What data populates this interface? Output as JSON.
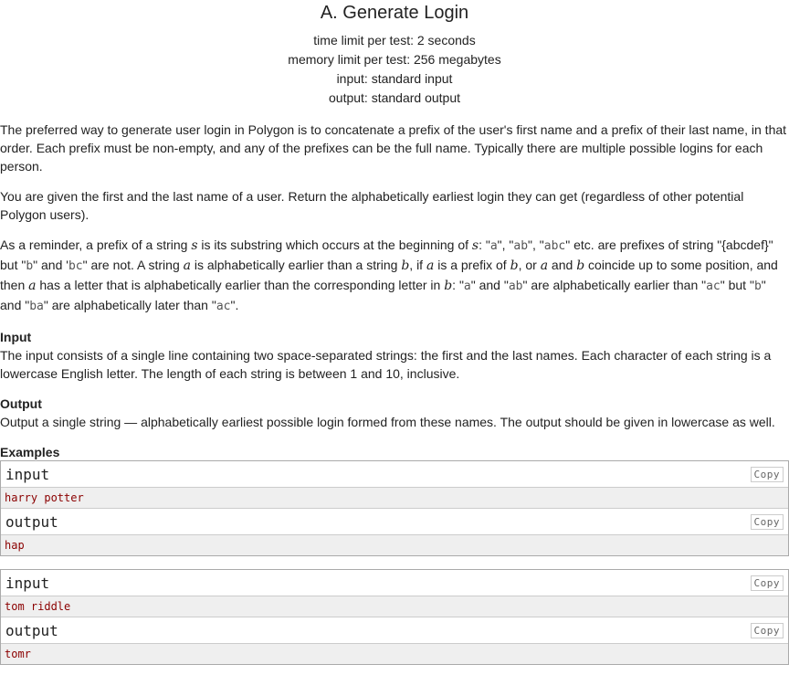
{
  "problem": {
    "title": "A. Generate Login",
    "time_limit": "time limit per test: 2 seconds",
    "memory_limit": "memory limit per test: 256 megabytes",
    "input": "input: standard input",
    "output": "output: standard output"
  },
  "statement": {
    "p1": "The preferred way to generate user login in Polygon is to concatenate a prefix of the user's first name and a prefix of their last name, in that order. Each prefix must be non-empty, and any of the prefixes can be the full name. Typically there are multiple possible logins for each person.",
    "p2": "You are given the first and the last name of a user. Return the alphabetically earliest login they can get (regardless of other potential Polygon users).",
    "p3": {
      "t1": "As a reminder, a prefix of a string ",
      "s": "s",
      "t2": " is its substring which occurs at the beginning of ",
      "t3": ": \"",
      "c_a": "a",
      "t4": "\", \"",
      "c_ab": "ab",
      "t5": "\", \"",
      "c_abc": "abc",
      "t6": "\" etc. are prefixes of string \"{abcdef}\" but \"",
      "c_b": "b",
      "t7": "\" and '",
      "c_bc": "bc",
      "t8": "\" are not. A string ",
      "a": "a",
      "t9": " is alphabetically earlier than a string ",
      "b": "b",
      "t10": ", if ",
      "t11": " is a prefix of ",
      "t12": ", or ",
      "t13": " and ",
      "t14": " coincide up to some position, and then ",
      "t15": " has a letter that is alphabetically earlier than the corresponding letter in ",
      "t16": ": \"",
      "c_a2": "a",
      "t17": "\" and \"",
      "c_ab2": "ab",
      "t18": "\" are alphabetically earlier than \"",
      "c_ac": "ac",
      "t19": "\" but \"",
      "c_b2": "b",
      "t20": "\" and \"",
      "c_ba": "ba",
      "t21": "\" are alphabetically later than \"",
      "c_ac2": "ac",
      "t22": "\"."
    }
  },
  "input_section": {
    "title": "Input",
    "text": "The input consists of a single line containing two space-separated strings: the first and the last names. Each character of each string is a lowercase English letter. The length of each string is between 1 and 10, inclusive."
  },
  "output_section": {
    "title": "Output",
    "text": "Output a single string — alphabetically earliest possible login formed from these names. The output should be given in lowercase as well."
  },
  "examples": {
    "title": "Examples",
    "input_label": "input",
    "output_label": "output",
    "copy_label": "Copy",
    "items": [
      {
        "input": "harry potter",
        "output": "hap"
      },
      {
        "input": "tom riddle",
        "output": "tomr"
      }
    ]
  }
}
